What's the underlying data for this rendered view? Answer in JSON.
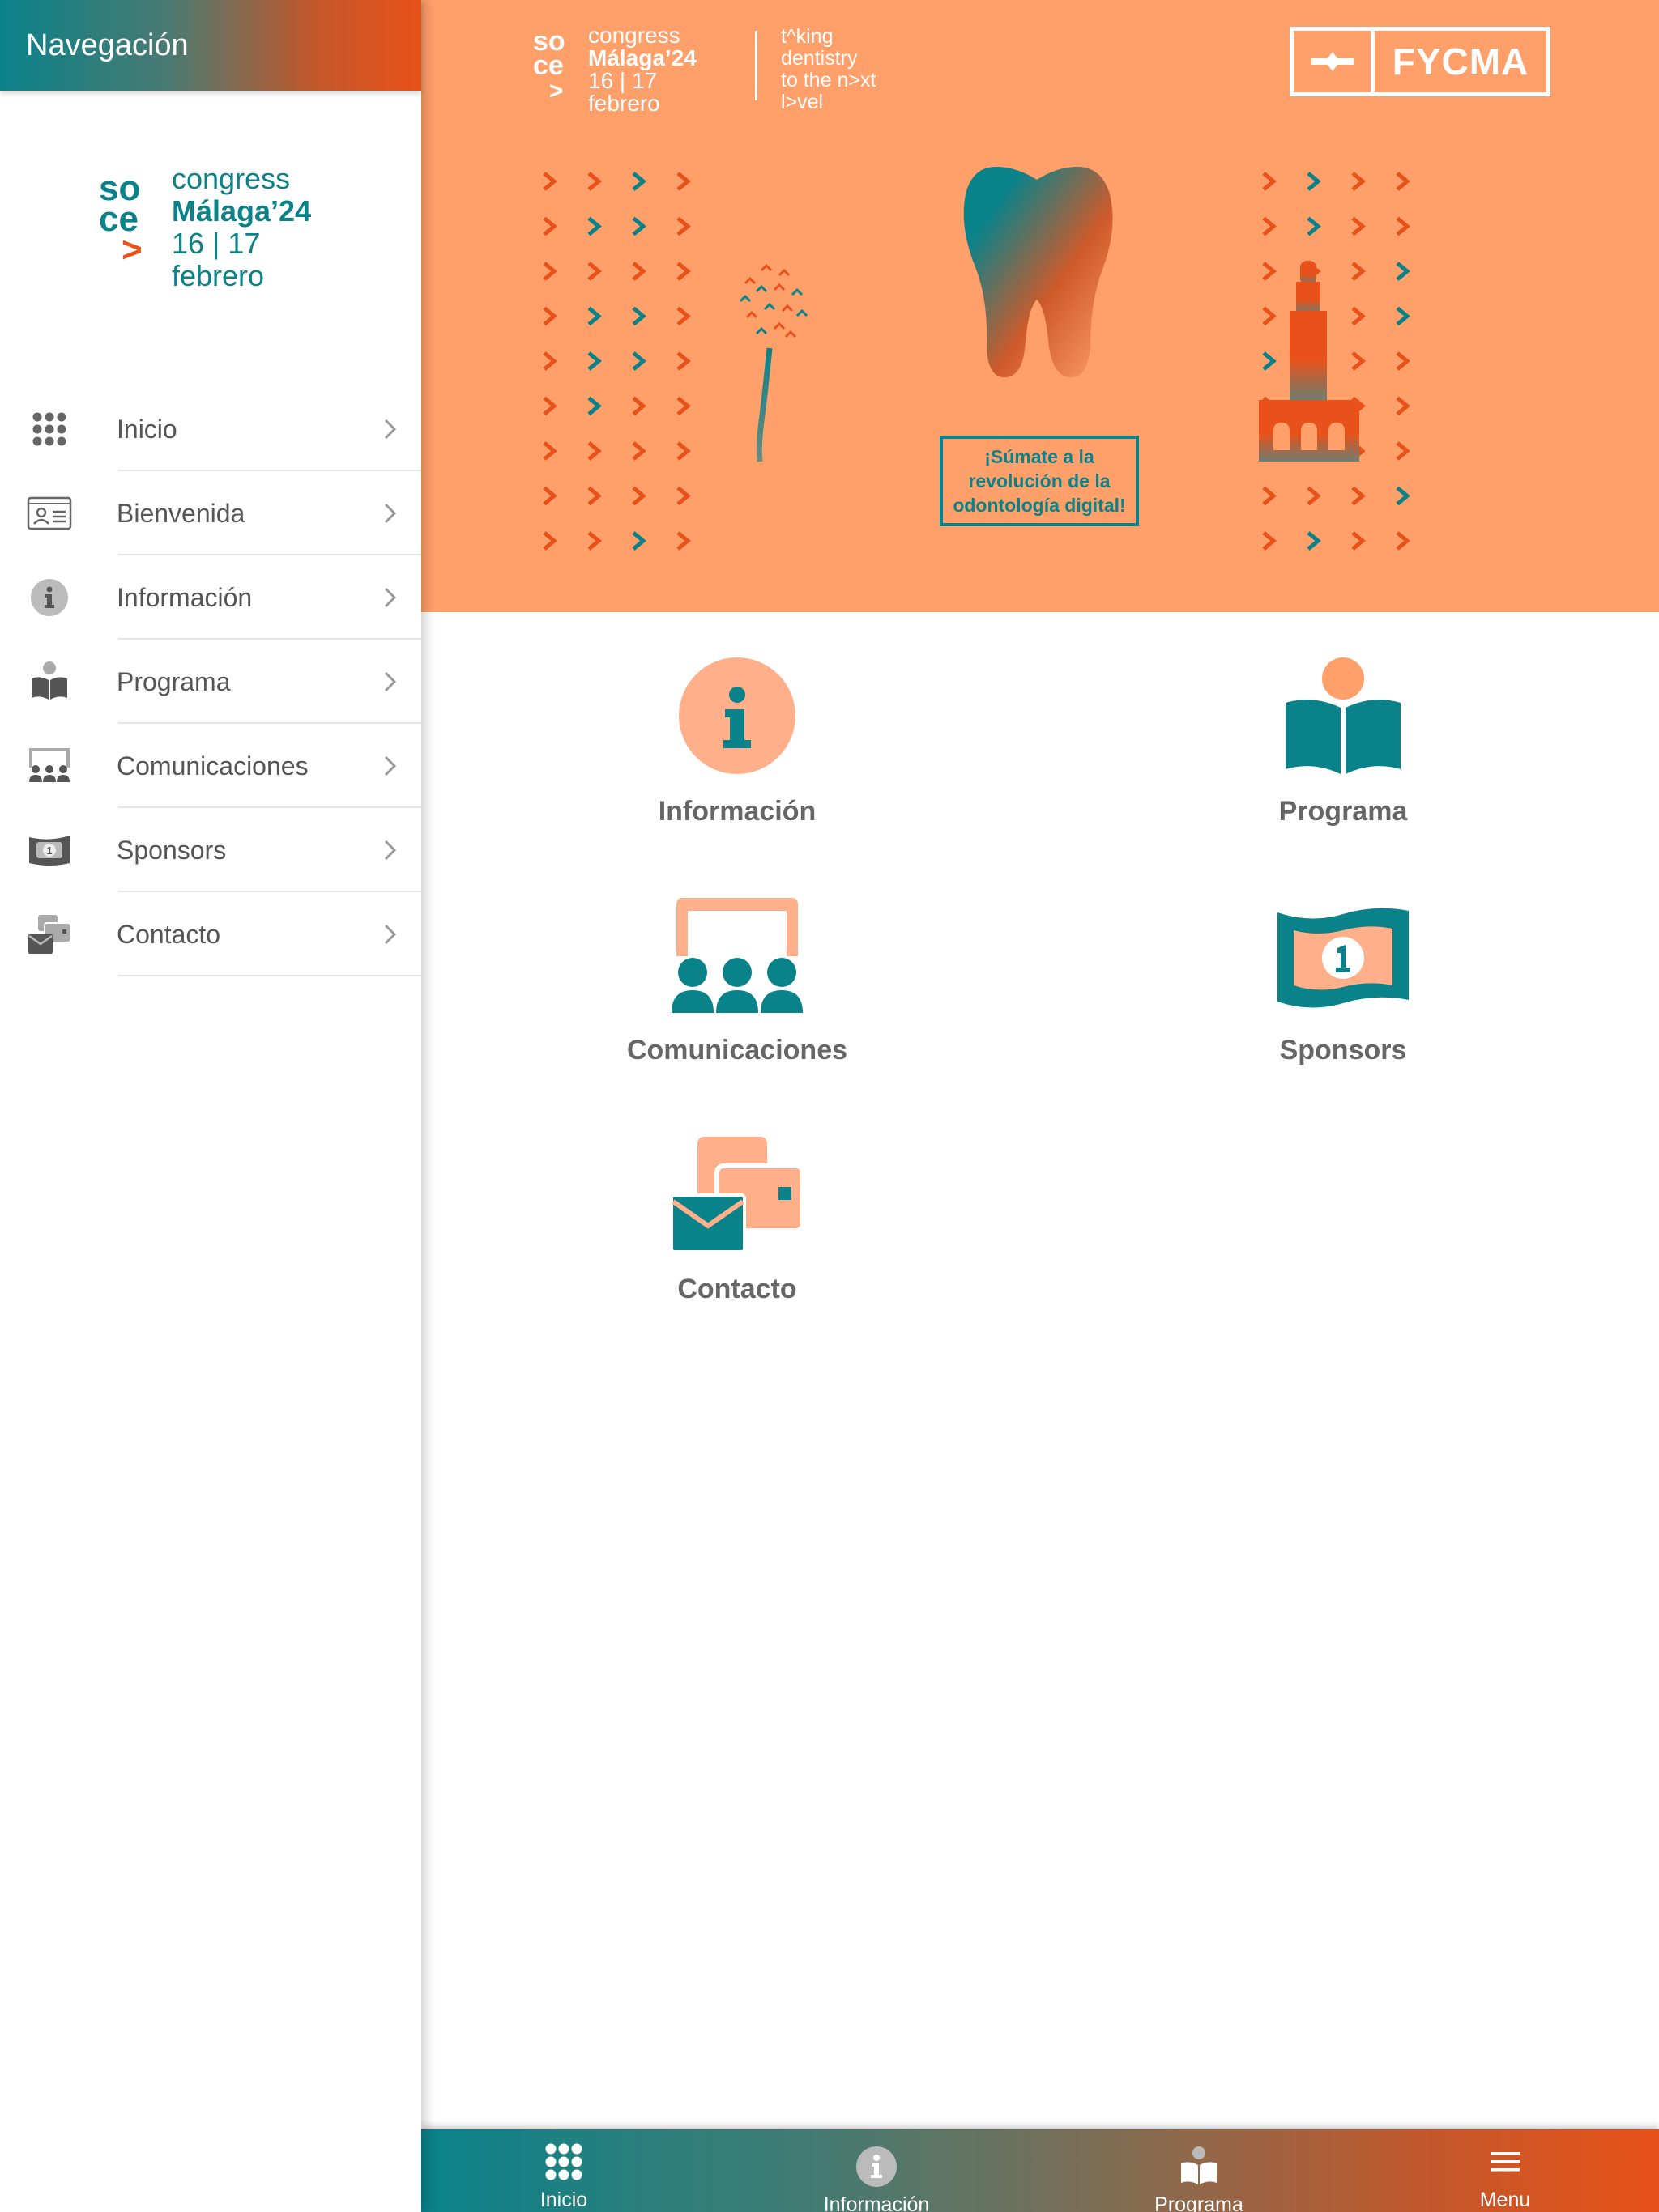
{
  "colors": {
    "teal": "#0a8289",
    "orange": "#e8521a",
    "peach": "#ffa06b",
    "tile_peach": "#ffb08a",
    "gray_text": "#555555"
  },
  "sidebar": {
    "title": "Navegación",
    "logo": {
      "line1": "congress",
      "line2": "Málaga’24",
      "line3": "16 | 17",
      "line4": "febrero",
      "mark": "so ce"
    },
    "items": [
      {
        "label": "Inicio",
        "icon": "grid-icon"
      },
      {
        "label": "Bienvenida",
        "icon": "id-card-icon"
      },
      {
        "label": "Información",
        "icon": "info-icon"
      },
      {
        "label": "Programa",
        "icon": "book-reader-icon"
      },
      {
        "label": "Comunicaciones",
        "icon": "presentation-icon"
      },
      {
        "label": "Sponsors",
        "icon": "money-icon"
      },
      {
        "label": "Contacto",
        "icon": "contact-icon"
      }
    ]
  },
  "banner": {
    "congress": {
      "line1": "congress",
      "line2": "Málaga’24",
      "line3": "16 | 17",
      "line4": "febrero"
    },
    "tagline": [
      "t^king",
      "dentistry",
      "to the n>xt",
      "l>vel"
    ],
    "partner": "FYCMA",
    "cta": "¡Súmate a la\nrevolución de la\nodontología digital!"
  },
  "tiles": [
    {
      "label": "Información",
      "icon": "info-icon"
    },
    {
      "label": "Programa",
      "icon": "book-reader-icon"
    },
    {
      "label": "Comunicaciones",
      "icon": "presentation-icon"
    },
    {
      "label": "Sponsors",
      "icon": "money-icon"
    },
    {
      "label": "Contacto",
      "icon": "contact-icon"
    }
  ],
  "bottom_bar": [
    {
      "label": "Inicio",
      "icon": "grid-icon"
    },
    {
      "label": "Información",
      "icon": "info-icon"
    },
    {
      "label": "Programa",
      "icon": "book-reader-icon"
    },
    {
      "label": "Menu",
      "icon": "hamburger-icon"
    }
  ]
}
